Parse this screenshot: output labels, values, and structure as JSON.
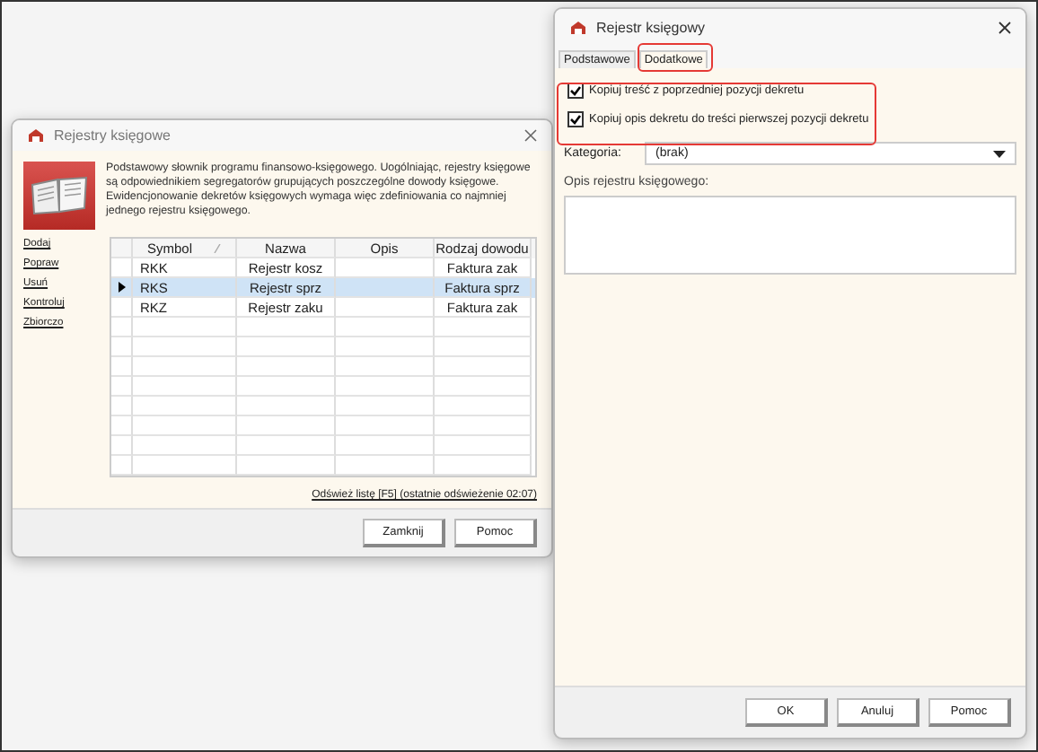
{
  "left_window": {
    "title": "Rejestry księgowe",
    "description": "Podstawowy słownik programu finansowo-księgowego. Uogólniając, rejestry księgowe są odpowiednikiem segregatorów grupujących poszczególne dowody księgowe. Ewidencjonowanie dekretów księgowych wymaga więc zdefiniowania co najmniej jednego rejestru księgowego.",
    "actions": [
      "Dodaj",
      "Popraw",
      "Usuń",
      "Kontroluj",
      "Zbiorczo"
    ],
    "table": {
      "columns": [
        "Symbol",
        "Nazwa",
        "Opis",
        "Rodzaj dowodu"
      ],
      "rows": [
        {
          "symbol": "RKK",
          "name": "Rejestr kosz",
          "document_type": "Faktura zak",
          "selected": false
        },
        {
          "symbol": "RKS",
          "name": "Rejestr sprz",
          "document_type": "Faktura sprz",
          "selected": true
        },
        {
          "symbol": "RKZ",
          "name": "Rejestr zaku",
          "document_type": "Faktura zak",
          "selected": false
        }
      ]
    },
    "refresh_link": "Odśwież listę [F5] (ostatnie odświeżenie 02:07)",
    "buttons": [
      "Zamknij",
      "Pomoc"
    ]
  },
  "right_window": {
    "title": "Rejestr księgowy",
    "tabs": [
      {
        "label": "Podstawowe",
        "selected": false
      },
      {
        "label": "Dodatkowe",
        "selected": true
      }
    ],
    "checkboxes": [
      {
        "label": "Kopiuj treść z poprzedniej pozycji dekretu",
        "checked": true
      },
      {
        "label": "Kopiuj opis dekretu do treści pierwszej pozycji dekretu",
        "checked": true
      }
    ],
    "category": {
      "label": "Kategoria:",
      "value": "(brak)"
    },
    "description_label": "Opis rejestru księgowego:",
    "buttons": [
      "OK",
      "Anuluj",
      "Pomoc"
    ]
  }
}
